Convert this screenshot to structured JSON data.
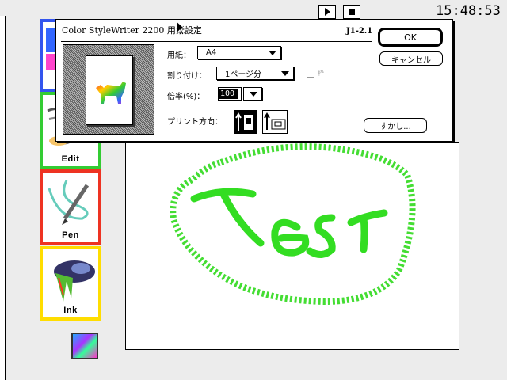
{
  "menubar": {
    "clock": "15:48:53",
    "play_icon": "play-icon",
    "stop_icon": "stop-icon"
  },
  "palette": {
    "items": [
      {
        "label": "Edit",
        "color": "#33cc33"
      },
      {
        "label": "Pen",
        "color": "#ee3322"
      },
      {
        "label": "Ink",
        "color": "#ffdd00"
      }
    ]
  },
  "canvas": {
    "drawing_text": "Test",
    "stroke_color": "#33dd22"
  },
  "dialog": {
    "title": "Color StyleWriter 2200 用紙設定",
    "version": "J1-2.1",
    "paper_label": "用紙：",
    "paper_value": "A4",
    "layout_label": "割り付け：",
    "layout_value": "1ページ分",
    "border_checkbox_label": "枠",
    "scale_label": "倍率(%)：",
    "scale_value": "100",
    "orientation_label": "プリント方向：",
    "ok_label": "OK",
    "cancel_label": "キャンセル",
    "watermark_label": "すかし..."
  }
}
